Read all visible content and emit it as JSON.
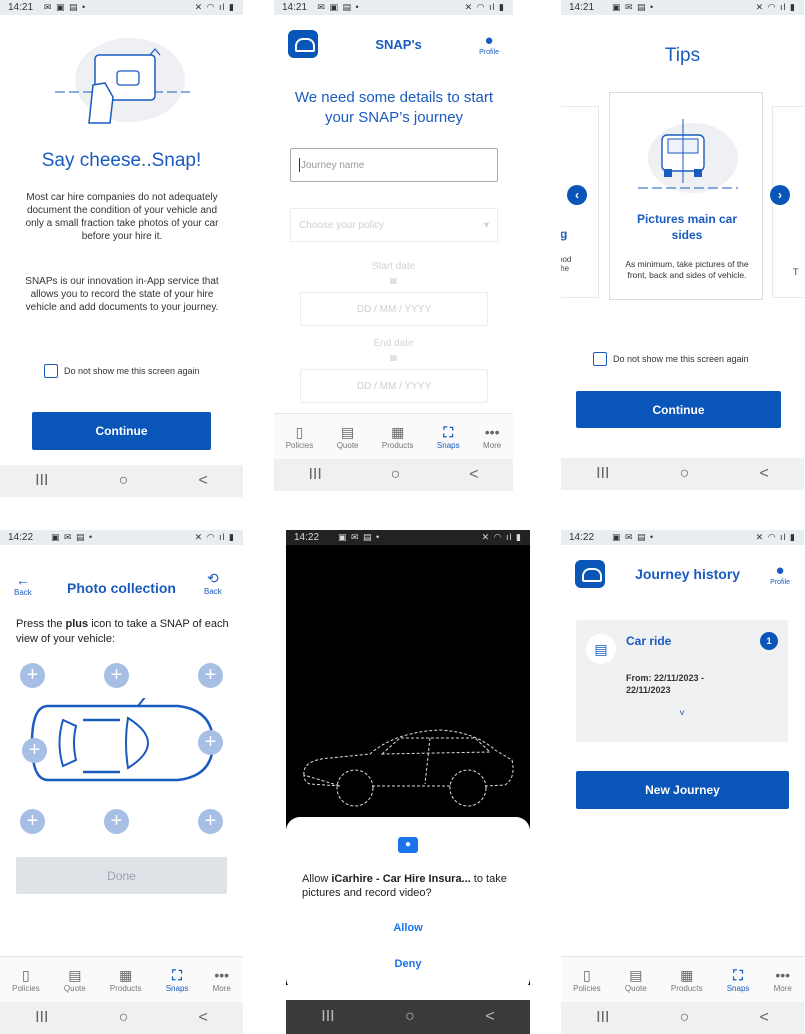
{
  "status": {
    "t1": "14:21",
    "t2": "14:21",
    "t3": "14:21",
    "t4": "14:22",
    "t5": "14:22",
    "t6": "14:22"
  },
  "tabs": [
    "Policies",
    "Quote",
    "Products",
    "Snaps",
    "More"
  ],
  "nav": {
    "recent": "III",
    "home": "○",
    "back": "<"
  },
  "panel1": {
    "title": "Say cheese..Snap!",
    "para1": "Most car hire companies do not adequately document the condition of your vehicle and only a small fraction take photos of your car before your hire it.",
    "para2": "SNAPs is our innovation in-App service that allows you to record the state of your hire vehicle and add documents to your journey.",
    "checkbox": "Do not show me this screen again",
    "continue": "Continue"
  },
  "panel2": {
    "header": "SNAP's",
    "profile": "Profile",
    "title": "We need some details to start your SNAP’s journey",
    "journey_placeholder": "Journey name",
    "policy_placeholder": "Choose your policy",
    "start_label": "Start date",
    "start_placeholder": "DD / MM / YYYY",
    "end_label": "End date",
    "end_placeholder": "DD / MM / YYYY"
  },
  "panel3": {
    "title": "Tips",
    "card_title": "Pictures main car sides",
    "card_text": "As minimum, take pictures of the front, back and sides of vehicle.",
    "left_frag_title": "g",
    "left_frag_text": "ood\nthe",
    "right_frag_text": "T",
    "checkbox": "Do not show me this screen again",
    "continue": "Continue"
  },
  "panel4": {
    "title": "Photo collection",
    "back_left": "Back",
    "back_right": "Back",
    "instr_pre": "Press the ",
    "instr_bold": "plus",
    "instr_post": " icon to take a SNAP of each view of your vehicle:",
    "done": "Done"
  },
  "panel5": {
    "allow_pre": "Allow ",
    "app_name": "iCarhire - Car Hire Insura...",
    "allow_post": " to take pictures and record video?",
    "allow": "Allow",
    "deny": "Deny"
  },
  "panel6": {
    "title": "Journey history",
    "profile": "Profile",
    "card_title": "Car ride",
    "badge": "1",
    "from": "From: 22/11/2023 - 22/11/2023",
    "chevron": "˅",
    "new_journey": "New Journey"
  }
}
